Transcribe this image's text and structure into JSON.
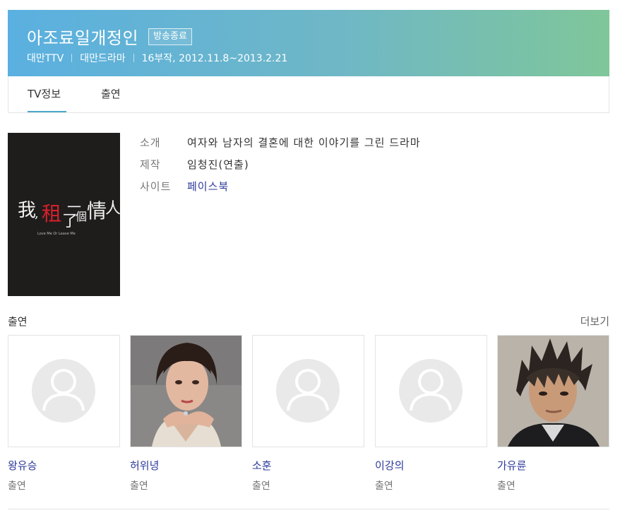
{
  "header": {
    "title": "아조료일개정인",
    "badge": "방송종료",
    "channel": "대만TTV",
    "genre": "대만드라마",
    "episodes": "16부작, 2012.11.8~2013.2.21"
  },
  "tabs": [
    {
      "label": "TV정보",
      "active": true
    },
    {
      "label": "출연",
      "active": false
    }
  ],
  "poster": {
    "logo_text": "我,租了一個情人",
    "logo_subtext": "Love Me  Or  Leave Me"
  },
  "info": {
    "intro_label": "소개",
    "intro_value": "여자와 남자의 결혼에 대한 이야기를 그린 드라마",
    "production_label": "제작",
    "production_value": "임청진(연출)",
    "site_label": "사이트",
    "site_value": "페이스북"
  },
  "cast": {
    "title": "출연",
    "more": "더보기",
    "items": [
      {
        "name": "왕유승",
        "role": "출연",
        "photo": "placeholder"
      },
      {
        "name": "허위녕",
        "role": "출연",
        "photo": "woman"
      },
      {
        "name": "소훈",
        "role": "출연",
        "photo": "placeholder"
      },
      {
        "name": "이강의",
        "role": "출연",
        "photo": "placeholder"
      },
      {
        "name": "가유륜",
        "role": "출연",
        "photo": "man"
      }
    ]
  },
  "colors": {
    "header_start": "#5ab0e0",
    "header_end": "#7fc69a",
    "link": "#2d3a9a",
    "tab_active": "#4aa8c9"
  }
}
